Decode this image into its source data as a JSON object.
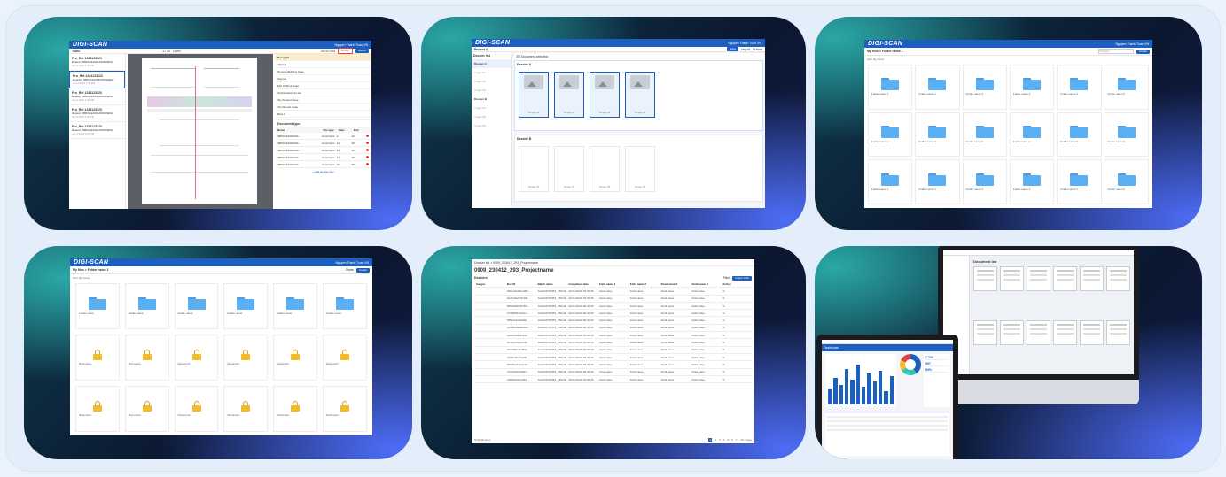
{
  "brand": {
    "logo": "DIGI-SCAN",
    "user": "Nguyen Thanh Tuan  VN"
  },
  "panel1": {
    "toolbar_title": "Tools",
    "zoom": "100%",
    "page": "1 / 10",
    "submit_label": "Submit",
    "delete_label": "Delete",
    "goto_label": "Go to Grid",
    "list_items": [
      {
        "title": "Pro_Ret 1234123123",
        "sub": "Reason: NB0C1E1004A0001SE02",
        "date": "Jan 4 2024 1:40 PM"
      },
      {
        "title": "Pro_Ret 1234123123",
        "sub": "Reason: NB0C1E1004A0001SE02",
        "date": "Jan 4 2024 1:40 PM"
      },
      {
        "title": "Pro_Ret 1234123123",
        "sub": "Reason: NB0C1E1004A0001SE02",
        "date": "Jan 4 2024 1:40 PM"
      },
      {
        "title": "Pro_Ret 1234123123",
        "sub": "Reason: NB0C1E1004A0001SE02",
        "date": "Jan 4 2024 1:40 PM"
      },
      {
        "title": "Pro_Ret 1234123123",
        "sub": "Reason: NB0C1E1004A0001SE02",
        "date": "Jan 4 2024 1:40 PM"
      }
    ],
    "right_title": "Document type",
    "right_cols": [
      "Name",
      "File type",
      "Start",
      "End"
    ],
    "right_rows": [
      [
        "NB0C1E1004A0F...",
        "Comments",
        "3",
        "10"
      ],
      [
        "NB0C1E1004A0F...",
        "Comments",
        "13",
        "15"
      ],
      [
        "NB0C1E1004A0F...",
        "Comments",
        "13",
        "15"
      ],
      [
        "NB0C1E1004A0F...",
        "Comments",
        "13",
        "15"
      ],
      [
        "NB0C1E1004A0F...",
        "Comments",
        "20",
        "25"
      ]
    ],
    "tree_items": [
      "Name list",
      "Alpha 1",
      "Remote Building Case",
      "Sample",
      "Met Hi Book Case",
      "Global Network Line",
      "Tax Amount Case",
      "Tax Record Case",
      "Beta 2"
    ],
    "add_label": "+ Add another box"
  },
  "panel2": {
    "project": "Project A",
    "section_title": "Dossier list",
    "selected_label": "3/3 Document selected",
    "doc_a": "Dossier A",
    "doc_b": "Dossier B",
    "side_items": [
      "Dossier A",
      "Image 01",
      "Image 02",
      "Image 03",
      "Dossier B",
      "Image 04",
      "Image 05",
      "Image 06"
    ],
    "image_labels": [
      "Image 01",
      "Image 02",
      "Image 03",
      "Image 04"
    ],
    "actions": [
      "Save",
      "Import",
      "Submit"
    ]
  },
  "panel3": {
    "crumb": "My files  >  Folder name 1",
    "sort": "Sort: By name",
    "create": "Create",
    "search_placeholder": "Search",
    "folders": [
      "Folder name 1",
      "Folder name 2",
      "Folder name 3",
      "Folder name 4",
      "Folder name 5",
      "Folder name 6",
      "Folder name 1",
      "Folder name 2",
      "Folder name 3",
      "Folder name 4",
      "Folder name 5",
      "Folder name 6",
      "Folder name 1",
      "Folder name 2",
      "Folder name 3",
      "Folder name 4",
      "Folder name 5",
      "Folder name 6"
    ]
  },
  "panel4": {
    "crumb": "My files  >  Folder name 1",
    "sort": "Sort: By name",
    "share": "Share",
    "create": "Create",
    "row1": [
      "Folder name",
      "Folder name",
      "Folder name",
      "Folder name",
      "Folder name",
      "Folder name"
    ],
    "row2": [
      "Document",
      "Document",
      "Document",
      "Document",
      "Document",
      "Document"
    ],
    "row3": [
      "Document",
      "Document",
      "Document",
      "Document",
      "Document",
      "Document"
    ]
  },
  "panel5": {
    "crumb": "Dossier list  >  0909_230412_293_Projectname",
    "title": "0909_230412_293_Projectname",
    "section": "Dossiers",
    "filter": "Filter",
    "import": "Import CSV",
    "cols": [
      "Images",
      "Doc ID",
      "Batch name",
      "Completed date",
      "Field name 1",
      "Field name 2",
      "Field name 3",
      "Field name 4",
      "Action"
    ],
    "rows": [
      [
        "6d8c13a49b1d4fb...",
        "ALEXMATIOB1_PROJECT",
        "02/11/2023, 09:00:18",
        "Field value",
        "Field value",
        "Field value",
        "Field value"
      ],
      [
        "1fe5b16e57fb4d0...",
        "ALEXMATIOB1_PROJECT",
        "02/11/2023, 09:00:18",
        "Field value",
        "Field value",
        "Field value",
        "Field value"
      ],
      [
        "f5923d60c1874f4...",
        "ALEXMATIOB1_PROJECT",
        "02/11/2023, 09:00:18",
        "Field value",
        "Field value",
        "Field value",
        "Field value"
      ],
      [
        "b74f2f8f2c944e1...",
        "ALEXMATIOB1_PROJECT",
        "02/11/2023, 09:00:18",
        "Field value",
        "Field value",
        "Field value",
        "Field value"
      ],
      [
        "00516c814a3f4b...",
        "ALEXMATIOB1_PROJECT",
        "02/11/2023, 09:00:18",
        "Field value",
        "Field value",
        "Field value",
        "Field value"
      ],
      [
        "e3529eb9a944e4...",
        "ALEXMATIOB1_PROJECT",
        "02/11/2023, 09:00:18",
        "Field value",
        "Field value",
        "Field value",
        "Field value"
      ],
      [
        "a4f95d8f8d1f4a2...",
        "ALEXMATIOB1_PROJECT",
        "02/11/2023, 09:00:18",
        "Field value",
        "Field value",
        "Field value",
        "Field value"
      ],
      [
        "5bd8a3d5a4f445...",
        "ALEXMATIOB1_PROJECT",
        "02/11/2023, 09:00:18",
        "Field value",
        "Field value",
        "Field value",
        "Field value"
      ],
      [
        "c07c90bc1b484a...",
        "ALEXMATIOB1_PROJECT",
        "02/11/2023, 09:00:18",
        "Field value",
        "Field value",
        "Field value",
        "Field value"
      ],
      [
        "2d51b35c77a94c...",
        "ALEXMATIOB1_PROJECT",
        "02/11/2023, 09:00:18",
        "Field value",
        "Field value",
        "Field value",
        "Field value"
      ],
      [
        "99ad5a3c4c2e4d...",
        "ALEXMATIOB1_PROJECT",
        "02/11/2023, 09:00:18",
        "Field value",
        "Field value",
        "Field value",
        "Field value"
      ],
      [
        "1e6f7a2b3c8d41...",
        "ALEXMATIOB1_PROJECT",
        "02/11/2023, 09:00:18",
        "Field value",
        "Field value",
        "Field value",
        "Field value"
      ],
      [
        "7a8b9c0d1e2f43...",
        "ALEXMATIOB1_PROJECT",
        "02/11/2023, 09:00:18",
        "Field value",
        "Field value",
        "Field value",
        "Field value"
      ]
    ],
    "total": "Total 56 items",
    "pages": [
      "1",
      "2",
      "3",
      "4",
      "5",
      "6",
      "7"
    ],
    "page_size": "20 / page"
  },
  "panel6": {
    "desktop_title": "Document list",
    "laptop_title": "Dashboard",
    "laptop_kpis": [
      "1,234",
      "567",
      "89%"
    ]
  },
  "colors": {
    "brand_blue": "#1d5fbf",
    "folder": "#5ab0f2",
    "lock": "#f2bb2c",
    "bg": "#eaf2fc"
  }
}
